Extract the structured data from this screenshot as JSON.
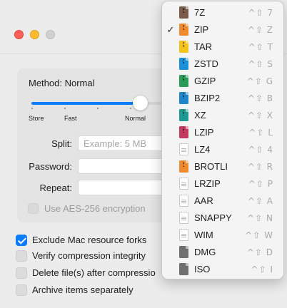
{
  "window": {
    "traffic_lights": [
      "close",
      "minimize",
      "zoom"
    ]
  },
  "compression": {
    "method_label": "Method: Normal",
    "slider": {
      "level_fraction": 0.66,
      "ticks": 6
    },
    "tick_labels": [
      "Store",
      "Fast",
      "Normal"
    ],
    "split_label": "Split:",
    "split_placeholder": "Example: 5 MB",
    "password_label": "Password:",
    "repeat_label": "Repeat:",
    "aes_label": "Use AES-256 encryption",
    "aes_checked": false
  },
  "options": [
    {
      "label": "Exclude Mac resource forks",
      "checked": true
    },
    {
      "label": "Verify compression integrity",
      "checked": false
    },
    {
      "label": "Delete file(s) after compressio",
      "checked": false
    },
    {
      "label": "Archive items separately",
      "checked": false
    }
  ],
  "format_menu": {
    "selected": "ZIP",
    "shortcut_prefix": "^⇧",
    "items": [
      {
        "label": "7Z",
        "key": "7",
        "icon": "archive-file-icon",
        "color": "#7a5a4a",
        "checked": false
      },
      {
        "label": "ZIP",
        "key": "Z",
        "icon": "archive-file-icon",
        "color": "#f08a2e",
        "checked": true
      },
      {
        "label": "TAR",
        "key": "T",
        "icon": "archive-file-icon",
        "color": "#f4c21c",
        "checked": false
      },
      {
        "label": "ZSTD",
        "key": "S",
        "icon": "archive-file-icon",
        "color": "#1b8fd8",
        "checked": false
      },
      {
        "label": "GZIP",
        "key": "G",
        "icon": "archive-file-icon",
        "color": "#2a9c58",
        "checked": false
      },
      {
        "label": "BZIP2",
        "key": "B",
        "icon": "archive-file-icon",
        "color": "#1e86c8",
        "checked": false
      },
      {
        "label": "XZ",
        "key": "X",
        "icon": "archive-file-icon",
        "color": "#1f9a92",
        "checked": false
      },
      {
        "label": "LZIP",
        "key": "L",
        "icon": "archive-file-icon",
        "color": "#c23a5e",
        "checked": false
      },
      {
        "label": "LZ4",
        "key": "4",
        "icon": "document-file-icon",
        "color": "#ffffff",
        "checked": false
      },
      {
        "label": "BROTLI",
        "key": "R",
        "icon": "archive-file-icon",
        "color": "#f08a2e",
        "checked": false
      },
      {
        "label": "LRZIP",
        "key": "P",
        "icon": "document-file-icon",
        "color": "#ffffff",
        "checked": false
      },
      {
        "label": "AAR",
        "key": "A",
        "icon": "document-file-icon",
        "color": "#ffffff",
        "checked": false
      },
      {
        "label": "SNAPPY",
        "key": "N",
        "icon": "document-file-icon",
        "color": "#ffffff",
        "checked": false
      },
      {
        "label": "WIM",
        "key": "W",
        "icon": "document-file-icon",
        "color": "#ffffff",
        "checked": false
      },
      {
        "label": "DMG",
        "key": "D",
        "icon": "disk-image-icon",
        "color": "#6f6f6f",
        "checked": false
      },
      {
        "label": "ISO",
        "key": "I",
        "icon": "disk-image-icon",
        "color": "#6f6f6f",
        "checked": false
      }
    ]
  }
}
